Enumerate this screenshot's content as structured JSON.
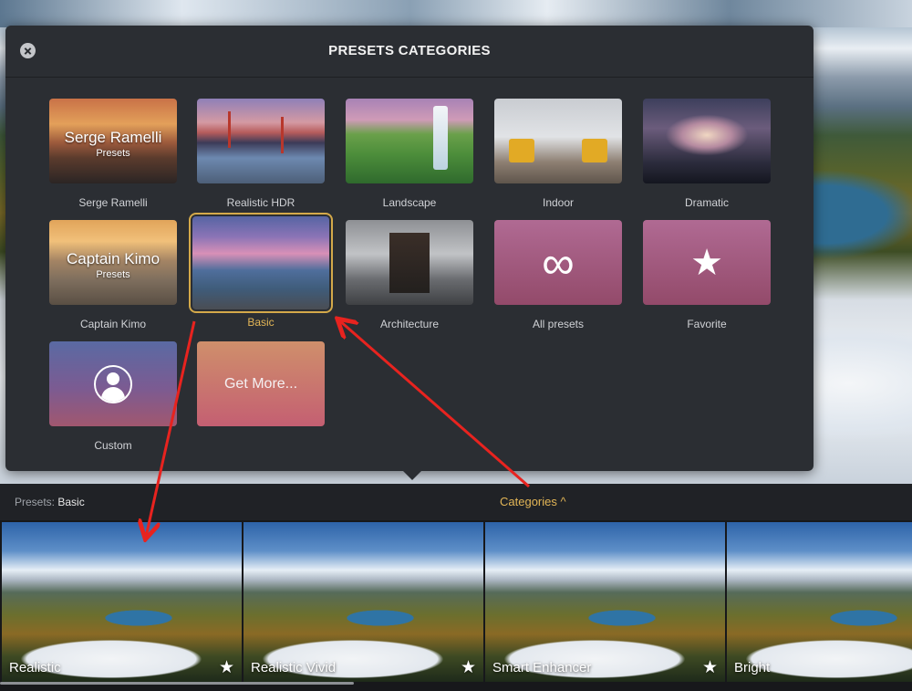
{
  "dialog": {
    "title": "PRESETS CATEGORIES"
  },
  "categories": [
    {
      "label": "Serge Ramelli",
      "thumb_title": "Serge Ramelli",
      "thumb_subtitle": "Presets"
    },
    {
      "label": "Realistic HDR"
    },
    {
      "label": "Landscape"
    },
    {
      "label": "Indoor"
    },
    {
      "label": "Dramatic"
    },
    {
      "label": "Captain Kimo",
      "thumb_title": "Captain Kimo",
      "thumb_subtitle": "Presets"
    },
    {
      "label": "Basic",
      "selected": true
    },
    {
      "label": "Architecture"
    },
    {
      "label": "All presets",
      "icon": "infinity-icon"
    },
    {
      "label": "Favorite",
      "icon": "star-icon"
    },
    {
      "label": "Custom",
      "icon": "user-circle-icon"
    },
    {
      "label": "",
      "thumb_title": "Get More..."
    }
  ],
  "presets_bar": {
    "prefix": "Presets:",
    "current": "Basic",
    "categories_toggle": "Categories ^"
  },
  "presets": [
    {
      "name": "Realistic",
      "favorite_icon": "star-icon"
    },
    {
      "name": "Realistic Vivid",
      "favorite_icon": "star-icon"
    },
    {
      "name": "Smart Enhancer",
      "favorite_icon": "star-icon"
    },
    {
      "name": "Bright"
    }
  ],
  "colors": {
    "accent": "#e2b556",
    "dialog_bg": "#2b2e33",
    "annotation_arrow": "#e8231f"
  }
}
